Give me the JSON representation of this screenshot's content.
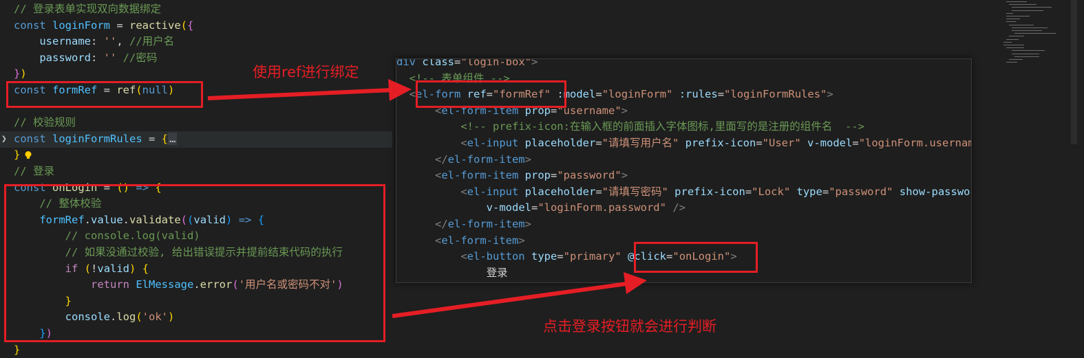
{
  "left_code": {
    "lines": [
      {
        "segs": [
          {
            "c": "c",
            "t": "// 登录表单实现双向数据绑定"
          }
        ]
      },
      {
        "segs": [
          {
            "c": "k",
            "t": "const "
          },
          {
            "c": "vc",
            "t": "loginForm"
          },
          {
            "c": "p",
            "t": " = "
          },
          {
            "c": "f",
            "t": "reactive"
          },
          {
            "c": "b1",
            "t": "("
          },
          {
            "c": "b2",
            "t": "{"
          }
        ]
      },
      {
        "segs": [
          {
            "c": "p",
            "t": "    "
          },
          {
            "c": "v",
            "t": "username"
          },
          {
            "c": "p",
            "t": ": "
          },
          {
            "c": "s",
            "t": "''"
          },
          {
            "c": "p",
            "t": ", "
          },
          {
            "c": "c",
            "t": "//用户名"
          }
        ]
      },
      {
        "segs": [
          {
            "c": "p",
            "t": "    "
          },
          {
            "c": "v",
            "t": "password"
          },
          {
            "c": "p",
            "t": ": "
          },
          {
            "c": "s",
            "t": "''"
          },
          {
            "c": "p",
            "t": " "
          },
          {
            "c": "c",
            "t": "//密码"
          }
        ]
      },
      {
        "segs": [
          {
            "c": "b2",
            "t": "}"
          },
          {
            "c": "b1",
            "t": ")"
          }
        ]
      },
      {
        "segs": [
          {
            "c": "k",
            "t": "const "
          },
          {
            "c": "vc",
            "t": "formRef"
          },
          {
            "c": "p",
            "t": " = "
          },
          {
            "c": "f",
            "t": "ref"
          },
          {
            "c": "b1",
            "t": "("
          },
          {
            "c": "k",
            "t": "null"
          },
          {
            "c": "b1",
            "t": ")"
          }
        ]
      },
      {
        "segs": []
      },
      {
        "segs": [
          {
            "c": "c",
            "t": "// 校验规则"
          }
        ]
      },
      {
        "segs": [
          {
            "c": "k",
            "t": "const "
          },
          {
            "c": "vc",
            "t": "loginFormRules"
          },
          {
            "c": "p",
            "t": " = "
          },
          {
            "c": "b1",
            "t": "{"
          },
          {
            "c": "fold-dots",
            "t": "…"
          }
        ]
      },
      {
        "segs": [
          {
            "c": "b1",
            "t": "}"
          }
        ]
      },
      {
        "segs": [
          {
            "c": "c",
            "t": "// 登录"
          }
        ]
      },
      {
        "segs": [
          {
            "c": "k",
            "t": "const "
          },
          {
            "c": "f",
            "t": "onLogin"
          },
          {
            "c": "p",
            "t": " = "
          },
          {
            "c": "b1",
            "t": "("
          },
          {
            "c": "b1",
            "t": ")"
          },
          {
            "c": "p",
            "t": " "
          },
          {
            "c": "k",
            "t": "=>"
          },
          {
            "c": "p",
            "t": " "
          },
          {
            "c": "b1",
            "t": "{"
          }
        ]
      },
      {
        "segs": [
          {
            "c": "p",
            "t": "    "
          },
          {
            "c": "c",
            "t": "// 整体校验"
          }
        ]
      },
      {
        "segs": [
          {
            "c": "p",
            "t": "    "
          },
          {
            "c": "vc",
            "t": "formRef"
          },
          {
            "c": "p",
            "t": "."
          },
          {
            "c": "v",
            "t": "value"
          },
          {
            "c": "p",
            "t": "."
          },
          {
            "c": "f",
            "t": "validate"
          },
          {
            "c": "b2",
            "t": "("
          },
          {
            "c": "b3",
            "t": "("
          },
          {
            "c": "v",
            "t": "valid"
          },
          {
            "c": "b3",
            "t": ")"
          },
          {
            "c": "p",
            "t": " "
          },
          {
            "c": "k",
            "t": "=>"
          },
          {
            "c": "p",
            "t": " "
          },
          {
            "c": "b3",
            "t": "{"
          }
        ]
      },
      {
        "segs": [
          {
            "c": "p",
            "t": "        "
          },
          {
            "c": "c",
            "t": "// console.log(valid)"
          }
        ]
      },
      {
        "segs": [
          {
            "c": "p",
            "t": "        "
          },
          {
            "c": "c",
            "t": "// 如果没通过校验, 给出错误提示并提前结束代码的执行"
          }
        ]
      },
      {
        "segs": [
          {
            "c": "p",
            "t": "        "
          },
          {
            "c": "kc",
            "t": "if"
          },
          {
            "c": "p",
            "t": " "
          },
          {
            "c": "b1",
            "t": "("
          },
          {
            "c": "p",
            "t": "!"
          },
          {
            "c": "v",
            "t": "valid"
          },
          {
            "c": "b1",
            "t": ")"
          },
          {
            "c": "p",
            "t": " "
          },
          {
            "c": "b1",
            "t": "{"
          }
        ]
      },
      {
        "segs": [
          {
            "c": "p",
            "t": "            "
          },
          {
            "c": "kc",
            "t": "return"
          },
          {
            "c": "p",
            "t": " "
          },
          {
            "c": "vc",
            "t": "ElMessage"
          },
          {
            "c": "p",
            "t": "."
          },
          {
            "c": "f",
            "t": "error"
          },
          {
            "c": "b2",
            "t": "("
          },
          {
            "c": "s",
            "t": "'用户名或密码不对'"
          },
          {
            "c": "b2",
            "t": ")"
          }
        ]
      },
      {
        "segs": [
          {
            "c": "p",
            "t": "        "
          },
          {
            "c": "b1",
            "t": "}"
          }
        ]
      },
      {
        "segs": [
          {
            "c": "p",
            "t": "        "
          },
          {
            "c": "v",
            "t": "console"
          },
          {
            "c": "p",
            "t": "."
          },
          {
            "c": "f",
            "t": "log"
          },
          {
            "c": "b1",
            "t": "("
          },
          {
            "c": "s",
            "t": "'ok'"
          },
          {
            "c": "b1",
            "t": ")"
          }
        ]
      },
      {
        "segs": [
          {
            "c": "p",
            "t": "    "
          },
          {
            "c": "b3",
            "t": "}"
          },
          {
            "c": "b2",
            "t": ")"
          }
        ]
      },
      {
        "segs": [
          {
            "c": "b1",
            "t": "}"
          }
        ]
      }
    ]
  },
  "popup_code": {
    "lines": [
      {
        "segs": [
          {
            "c": "t",
            "t": "div "
          },
          {
            "c": "a",
            "t": "class"
          },
          {
            "c": "p",
            "t": "="
          },
          {
            "c": "sv",
            "t": "\"login-box\""
          },
          {
            "c": "g",
            "t": ">"
          }
        ]
      },
      {
        "segs": [
          {
            "c": "g",
            "t": "  "
          },
          {
            "c": "cm",
            "t": "<!-- 表单组件 -->"
          }
        ]
      },
      {
        "segs": [
          {
            "c": "g",
            "t": "  <"
          },
          {
            "c": "t",
            "t": "el-form"
          },
          {
            "c": "p",
            "t": " "
          },
          {
            "c": "a",
            "t": "ref"
          },
          {
            "c": "p",
            "t": "="
          },
          {
            "c": "sv",
            "t": "\"formRef\""
          },
          {
            "c": "p",
            "t": " "
          },
          {
            "c": "a",
            "t": ":model"
          },
          {
            "c": "p",
            "t": "="
          },
          {
            "c": "sv",
            "t": "\"loginForm\""
          },
          {
            "c": "p",
            "t": " "
          },
          {
            "c": "a",
            "t": ":rules"
          },
          {
            "c": "p",
            "t": "="
          },
          {
            "c": "sv",
            "t": "\"loginFormRules\""
          },
          {
            "c": "g",
            "t": ">"
          }
        ]
      },
      {
        "segs": [
          {
            "c": "g",
            "t": "      <"
          },
          {
            "c": "t",
            "t": "el-form-item"
          },
          {
            "c": "p",
            "t": " "
          },
          {
            "c": "a",
            "t": "prop"
          },
          {
            "c": "p",
            "t": "="
          },
          {
            "c": "sv",
            "t": "\"username\""
          },
          {
            "c": "g",
            "t": ">"
          }
        ]
      },
      {
        "segs": [
          {
            "c": "g",
            "t": "          "
          },
          {
            "c": "cm",
            "t": "<!-- prefix-icon:在输入框的前面插入字体图标,里面写的是注册的组件名  -->"
          }
        ]
      },
      {
        "segs": [
          {
            "c": "g",
            "t": "          <"
          },
          {
            "c": "t",
            "t": "el-input"
          },
          {
            "c": "p",
            "t": " "
          },
          {
            "c": "a",
            "t": "placeholder"
          },
          {
            "c": "p",
            "t": "="
          },
          {
            "c": "sv",
            "t": "\"请填写用户名\""
          },
          {
            "c": "p",
            "t": " "
          },
          {
            "c": "a",
            "t": "prefix-icon"
          },
          {
            "c": "p",
            "t": "="
          },
          {
            "c": "sv",
            "t": "\"User\""
          },
          {
            "c": "p",
            "t": " "
          },
          {
            "c": "a",
            "t": "v-model"
          },
          {
            "c": "p",
            "t": "="
          },
          {
            "c": "sv",
            "t": "\"loginForm.username\""
          },
          {
            "c": "p",
            "t": " "
          },
          {
            "c": "g",
            "t": "/>"
          }
        ]
      },
      {
        "segs": [
          {
            "c": "g",
            "t": "      </"
          },
          {
            "c": "t",
            "t": "el-form-item"
          },
          {
            "c": "g",
            "t": ">"
          }
        ]
      },
      {
        "segs": [
          {
            "c": "g",
            "t": "      <"
          },
          {
            "c": "t",
            "t": "el-form-item"
          },
          {
            "c": "p",
            "t": " "
          },
          {
            "c": "a",
            "t": "prop"
          },
          {
            "c": "p",
            "t": "="
          },
          {
            "c": "sv",
            "t": "\"password\""
          },
          {
            "c": "g",
            "t": ">"
          }
        ]
      },
      {
        "segs": [
          {
            "c": "g",
            "t": "          <"
          },
          {
            "c": "t",
            "t": "el-input"
          },
          {
            "c": "p",
            "t": " "
          },
          {
            "c": "a",
            "t": "placeholder"
          },
          {
            "c": "p",
            "t": "="
          },
          {
            "c": "sv",
            "t": "\"请填写密码\""
          },
          {
            "c": "p",
            "t": " "
          },
          {
            "c": "a",
            "t": "prefix-icon"
          },
          {
            "c": "p",
            "t": "="
          },
          {
            "c": "sv",
            "t": "\"Lock\""
          },
          {
            "c": "p",
            "t": " "
          },
          {
            "c": "a",
            "t": "type"
          },
          {
            "c": "p",
            "t": "="
          },
          {
            "c": "sv",
            "t": "\"password\""
          },
          {
            "c": "p",
            "t": " "
          },
          {
            "c": "a",
            "t": "show-password"
          }
        ]
      },
      {
        "segs": [
          {
            "c": "p",
            "t": "              "
          },
          {
            "c": "a",
            "t": "v-model"
          },
          {
            "c": "p",
            "t": "="
          },
          {
            "c": "sv",
            "t": "\"loginForm.password\""
          },
          {
            "c": "p",
            "t": " "
          },
          {
            "c": "g",
            "t": "/>"
          }
        ]
      },
      {
        "segs": [
          {
            "c": "g",
            "t": "      </"
          },
          {
            "c": "t",
            "t": "el-form-item"
          },
          {
            "c": "g",
            "t": ">"
          }
        ]
      },
      {
        "segs": [
          {
            "c": "g",
            "t": "      <"
          },
          {
            "c": "t",
            "t": "el-form-item"
          },
          {
            "c": "g",
            "t": ">"
          }
        ]
      },
      {
        "segs": [
          {
            "c": "g",
            "t": "          <"
          },
          {
            "c": "t",
            "t": "el-button"
          },
          {
            "c": "p",
            "t": " "
          },
          {
            "c": "a",
            "t": "type"
          },
          {
            "c": "p",
            "t": "="
          },
          {
            "c": "sv",
            "t": "\"primary\""
          },
          {
            "c": "p",
            "t": " "
          },
          {
            "c": "a",
            "t": "@click"
          },
          {
            "c": "p",
            "t": "="
          },
          {
            "c": "sv",
            "t": "\"onLogin\""
          },
          {
            "c": "g",
            "t": ">"
          }
        ]
      },
      {
        "segs": [
          {
            "c": "p",
            "t": "              登录"
          }
        ]
      }
    ]
  },
  "annotations": {
    "label_ref": "使用ref进行绑定",
    "label_click": "点击登录按钮就会进行判断"
  },
  "colors": {
    "annotation": "#e51e25",
    "editor_bg": "#1f1f1f"
  }
}
